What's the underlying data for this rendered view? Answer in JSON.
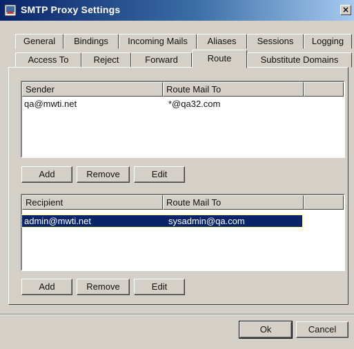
{
  "window": {
    "title": "SMTP Proxy Settings",
    "close_label": "×"
  },
  "tabs": {
    "row1": [
      "General",
      "Bindings",
      "Incoming Mails",
      "Aliases",
      "Sessions",
      "Logging"
    ],
    "row2": [
      "Access To",
      "Reject",
      "Forward",
      "Route",
      "Substitute Domains"
    ],
    "active": "Route"
  },
  "sender_list": {
    "columns": [
      "Sender",
      "Route Mail To",
      ""
    ],
    "rows": [
      {
        "sender": "qa@mwti.net",
        "route": "*@qa32.com",
        "selected": false
      }
    ]
  },
  "sender_buttons": {
    "add": "Add",
    "remove": "Remove",
    "edit": "Edit"
  },
  "recipient_list": {
    "columns": [
      "Recipient",
      "Route Mail To",
      ""
    ],
    "rows": [
      {
        "recipient": "admin@mwti.net",
        "route": "sysadmin@qa.com",
        "selected": true
      }
    ]
  },
  "recipient_buttons": {
    "add": "Add",
    "remove": "Remove",
    "edit": "Edit"
  },
  "dialog_buttons": {
    "ok": "Ok",
    "cancel": "Cancel"
  }
}
